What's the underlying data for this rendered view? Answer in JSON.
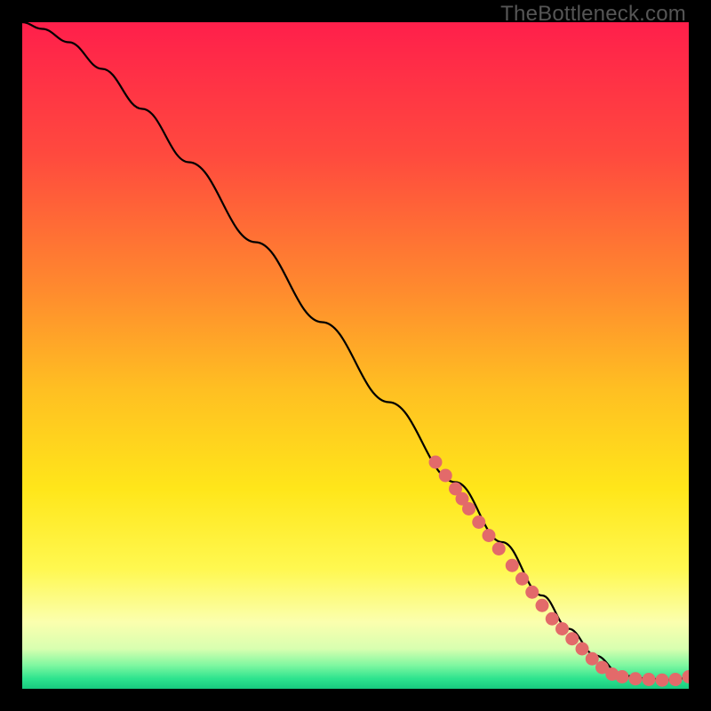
{
  "watermark": "TheBottleneck.com",
  "colors": {
    "bg": "#000000",
    "curve": "#000000",
    "dot": "#e36a6a",
    "watermark": "#555555"
  },
  "gradient_stops": [
    {
      "offset": 0.0,
      "color": "#ff1f4b"
    },
    {
      "offset": 0.2,
      "color": "#ff4a3e"
    },
    {
      "offset": 0.4,
      "color": "#ff8a2e"
    },
    {
      "offset": 0.55,
      "color": "#ffbf22"
    },
    {
      "offset": 0.7,
      "color": "#ffe61a"
    },
    {
      "offset": 0.82,
      "color": "#fff850"
    },
    {
      "offset": 0.9,
      "color": "#fbffae"
    },
    {
      "offset": 0.94,
      "color": "#d8ffb0"
    },
    {
      "offset": 0.965,
      "color": "#7ef7a0"
    },
    {
      "offset": 0.985,
      "color": "#2de38e"
    },
    {
      "offset": 1.0,
      "color": "#18c97f"
    }
  ],
  "chart_data": {
    "type": "line",
    "title": "",
    "xlabel": "",
    "ylabel": "",
    "xlim": [
      0,
      100
    ],
    "ylim": [
      0,
      100
    ],
    "series": [
      {
        "name": "curve",
        "x": [
          0,
          3,
          7,
          12,
          18,
          25,
          35,
          45,
          55,
          65,
          72,
          78,
          82,
          86,
          90,
          94,
          98,
          100
        ],
        "y": [
          100,
          99,
          97,
          93,
          87,
          79,
          67,
          55,
          43,
          31,
          22,
          14,
          9,
          5,
          2,
          1.5,
          1.3,
          1.8
        ]
      }
    ],
    "highlight_points": [
      {
        "x": 62,
        "y": 34
      },
      {
        "x": 63.5,
        "y": 32
      },
      {
        "x": 65,
        "y": 30
      },
      {
        "x": 66,
        "y": 28.5
      },
      {
        "x": 67,
        "y": 27
      },
      {
        "x": 68.5,
        "y": 25
      },
      {
        "x": 70,
        "y": 23
      },
      {
        "x": 71.5,
        "y": 21
      },
      {
        "x": 73.5,
        "y": 18.5
      },
      {
        "x": 75,
        "y": 16.5
      },
      {
        "x": 76.5,
        "y": 14.5
      },
      {
        "x": 78,
        "y": 12.5
      },
      {
        "x": 79.5,
        "y": 10.5
      },
      {
        "x": 81,
        "y": 9
      },
      {
        "x": 82.5,
        "y": 7.5
      },
      {
        "x": 84,
        "y": 6
      },
      {
        "x": 85.5,
        "y": 4.5
      },
      {
        "x": 87,
        "y": 3.2
      },
      {
        "x": 88.5,
        "y": 2.2
      },
      {
        "x": 90,
        "y": 1.8
      },
      {
        "x": 92,
        "y": 1.5
      },
      {
        "x": 94,
        "y": 1.4
      },
      {
        "x": 96,
        "y": 1.3
      },
      {
        "x": 98,
        "y": 1.4
      },
      {
        "x": 100,
        "y": 1.8
      }
    ]
  }
}
